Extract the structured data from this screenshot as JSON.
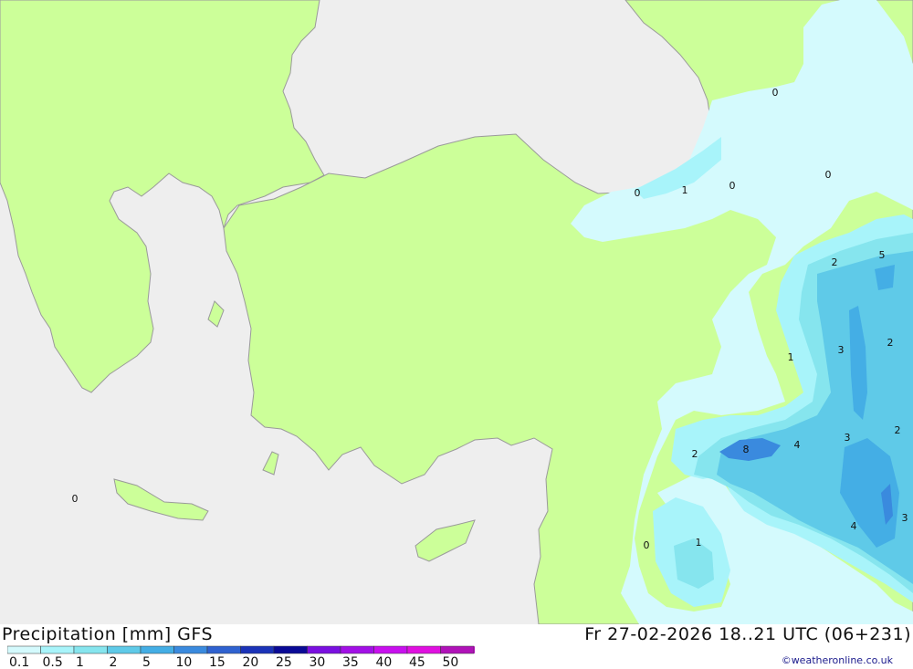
{
  "title": "Precipitation [mm] GFS",
  "run_info": "Fr 27-02-2026 18..21 UTC (06+231)",
  "credit": "©weatheronline.co.uk",
  "colors": {
    "sea": "#eeeeee",
    "land": "#ccff99",
    "border": "#9a9a9a",
    "precip_0_1": "#d4fafd",
    "precip_0_5": "#a8f4fa",
    "precip_1": "#86e5ee",
    "precip_2": "#5fcae8",
    "precip_5": "#44aee5",
    "precip_10": "#3a8ade"
  },
  "legend": {
    "labels": [
      "0.1",
      "0.5",
      "1",
      "2",
      "5",
      "10",
      "15",
      "20",
      "25",
      "30",
      "35",
      "40",
      "45",
      "50"
    ],
    "colors": [
      "#d4fafd",
      "#a8f4fa",
      "#86e5ee",
      "#5fcae8",
      "#44aee5",
      "#3a8ade",
      "#2f62d0",
      "#1b33b8",
      "#0a0a96",
      "#7a10e0",
      "#a210e6",
      "#c810ee",
      "#e010e0",
      "#b012b8"
    ]
  },
  "values": [
    {
      "label": "0"
    },
    {
      "label": "0"
    },
    {
      "label": "1"
    },
    {
      "label": "0"
    },
    {
      "label": "0"
    },
    {
      "label": "0"
    },
    {
      "label": "2"
    },
    {
      "label": "5"
    },
    {
      "label": "1"
    },
    {
      "label": "3"
    },
    {
      "label": "2"
    },
    {
      "label": "2"
    },
    {
      "label": "8"
    },
    {
      "label": "4"
    },
    {
      "label": "3"
    },
    {
      "label": "2"
    },
    {
      "label": "4"
    },
    {
      "label": "3"
    },
    {
      "label": "0"
    },
    {
      "label": "1"
    }
  ]
}
